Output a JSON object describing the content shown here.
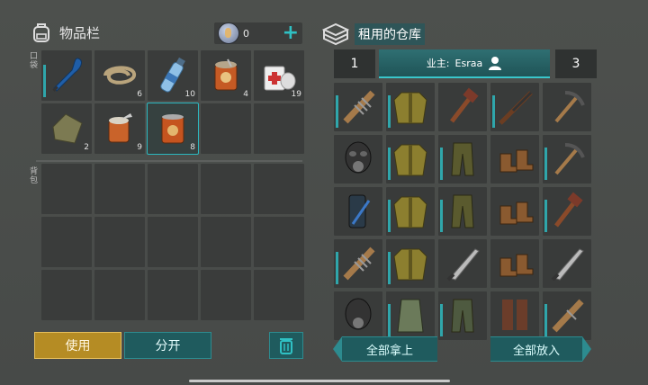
{
  "inventory": {
    "title": "物品栏",
    "currency": {
      "value": "0",
      "add_icon": "plus-icon"
    },
    "pocket_label": "口袋",
    "backpack_label": "背包",
    "pocket_slots": [
      {
        "item": "paddle-icon",
        "count": ""
      },
      {
        "item": "rope-icon",
        "count": "6"
      },
      {
        "item": "water-bottle-icon",
        "count": "10"
      },
      {
        "item": "stew-can-icon",
        "count": "4"
      },
      {
        "item": "first-aid-icon",
        "count": "19"
      },
      {
        "item": "cloth-sack-icon",
        "count": "2"
      },
      {
        "item": "open-can-icon",
        "count": "9"
      },
      {
        "item": "canned-food-icon",
        "count": "8",
        "selected": true
      },
      {
        "item": "",
        "count": ""
      },
      {
        "item": "",
        "count": ""
      }
    ],
    "buttons": {
      "use": "使用",
      "split": "分开",
      "trash_icon": "trash-icon"
    }
  },
  "warehouse": {
    "title": "租用的仓库",
    "tabs": {
      "left": "1",
      "owner_prefix": "业主:",
      "owner_name": "Esraa",
      "right": "3"
    },
    "items": [
      "spiked-bat-icon",
      "jacket-icon",
      "hammer-icon",
      "rifle-icon",
      "pickaxe-icon",
      "gas-mask-icon",
      "jacket-icon",
      "pants-icon",
      "boots-icon",
      "pickaxe-icon",
      "canister-icon",
      "jacket-icon",
      "pants-icon",
      "boots-icon",
      "hammer-icon",
      "spiked-bat-icon",
      "jacket-icon",
      "machete-icon",
      "boots-icon",
      "machete-icon",
      "gas-mask-icon",
      "vest-icon",
      "pants-icon",
      "tall-boots-icon",
      "spiked-bat-icon"
    ],
    "buttons": {
      "take_all": "全部拿上",
      "put_all": "全部放入"
    }
  },
  "colors": {
    "accent": "#2fb7bd",
    "use_button": "#b58c24",
    "panel": "#3a3c3b"
  }
}
